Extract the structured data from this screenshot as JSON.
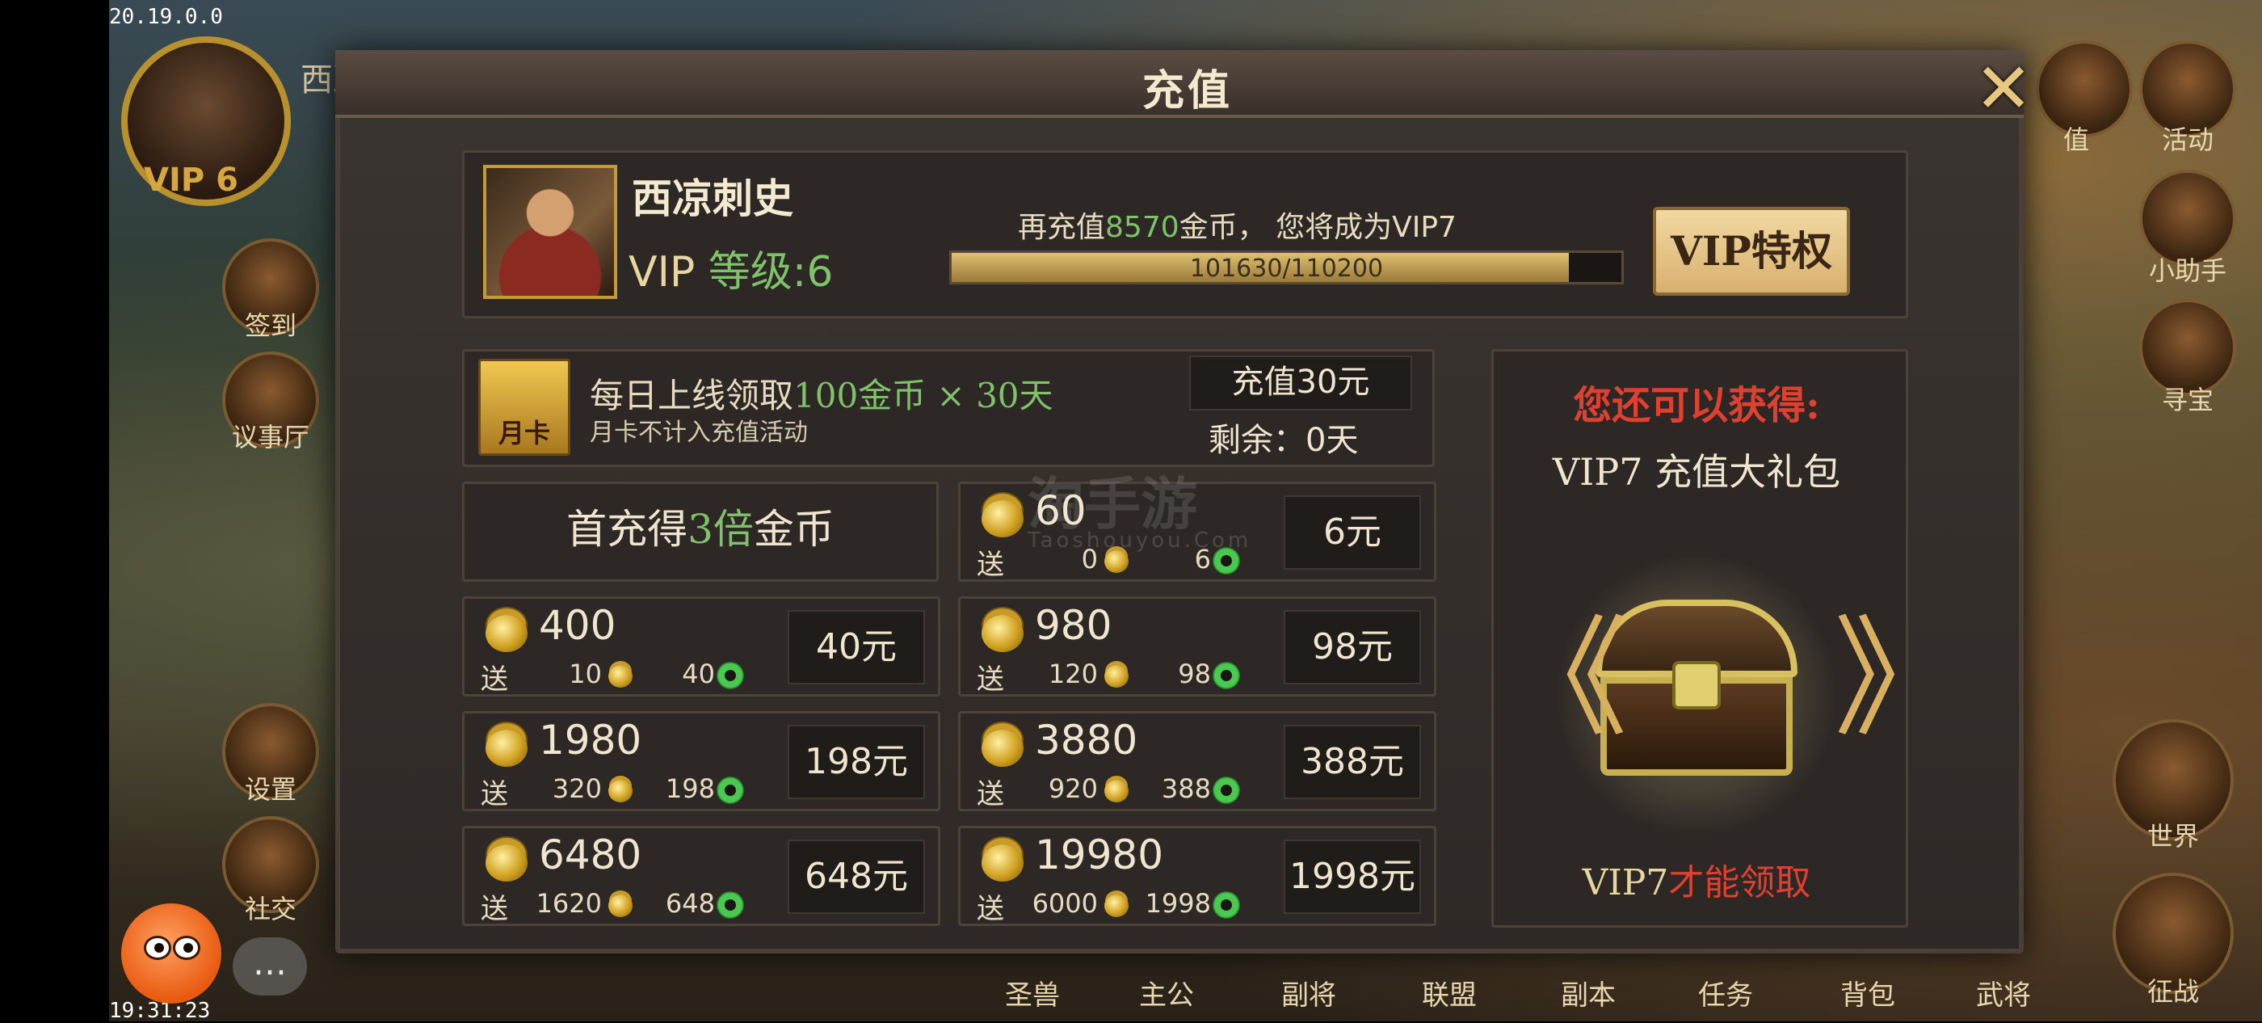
{
  "hud": {
    "version": "20.19.0.0",
    "clock": "19:31:23",
    "player_name_bg": "西凉",
    "vip_bg": "VIP 6",
    "side_left": [
      "签到",
      "议事厅",
      "设置",
      "社交"
    ],
    "side_right": [
      "值",
      "活动",
      "小助手",
      "寻宝",
      "世界",
      "征战"
    ],
    "bottom": [
      "圣兽",
      "主公",
      "副将",
      "联盟",
      "副本",
      "任务",
      "背包",
      "武将"
    ]
  },
  "modal": {
    "title": "充值",
    "close_icon": "close-x-icon",
    "player": {
      "name": "西凉刺史",
      "vip_prefix": "VIP",
      "level_label": "等级:",
      "level": "6"
    },
    "upgrade": {
      "prefix": "再充值",
      "amount": "8570",
      "suffix": "金币，  您将成为VIP7",
      "progress_text": "101630/110200",
      "progress_fraction": 0.922
    },
    "vip_button": "VIP特权",
    "monthly_card": {
      "icon_label": "月卡",
      "line1_prefix": "每日上线领取",
      "line1_highlight": "100金币 × 30天",
      "line2": "月卡不计入充值活动",
      "price": "充值30元",
      "remain": "剩余：0天"
    },
    "first_charge": {
      "prefix": "首充得",
      "highlight": "3倍",
      "suffix": "金币"
    },
    "send_label": "送",
    "packages": [
      {
        "amount": "60",
        "bonus_coin": "0",
        "bonus_gem": "6",
        "price": "6元"
      },
      {
        "amount": "400",
        "bonus_coin": "10",
        "bonus_gem": "40",
        "price": "40元"
      },
      {
        "amount": "980",
        "bonus_coin": "120",
        "bonus_gem": "98",
        "price": "98元"
      },
      {
        "amount": "1980",
        "bonus_coin": "320",
        "bonus_gem": "198",
        "price": "198元"
      },
      {
        "amount": "3880",
        "bonus_coin": "920",
        "bonus_gem": "388",
        "price": "388元"
      },
      {
        "amount": "6480",
        "bonus_coin": "1620",
        "bonus_gem": "648",
        "price": "648元"
      },
      {
        "amount": "19980",
        "bonus_coin": "6000",
        "bonus_gem": "1998",
        "price": "1998元"
      }
    ],
    "reward": {
      "title": "您还可以获得:",
      "subtitle": "VIP7 充值大礼包",
      "cond_prefix": "VIP7",
      "cond_suffix": "才能领取",
      "left_arrow": "《",
      "right_arrow": "》"
    },
    "watermark": "淘手游",
    "watermark_sub": "Taoshouyou.Com"
  },
  "colors": {
    "accent_green": "#7ec26a",
    "accent_red": "#e04030",
    "gold": "#d8b060"
  }
}
